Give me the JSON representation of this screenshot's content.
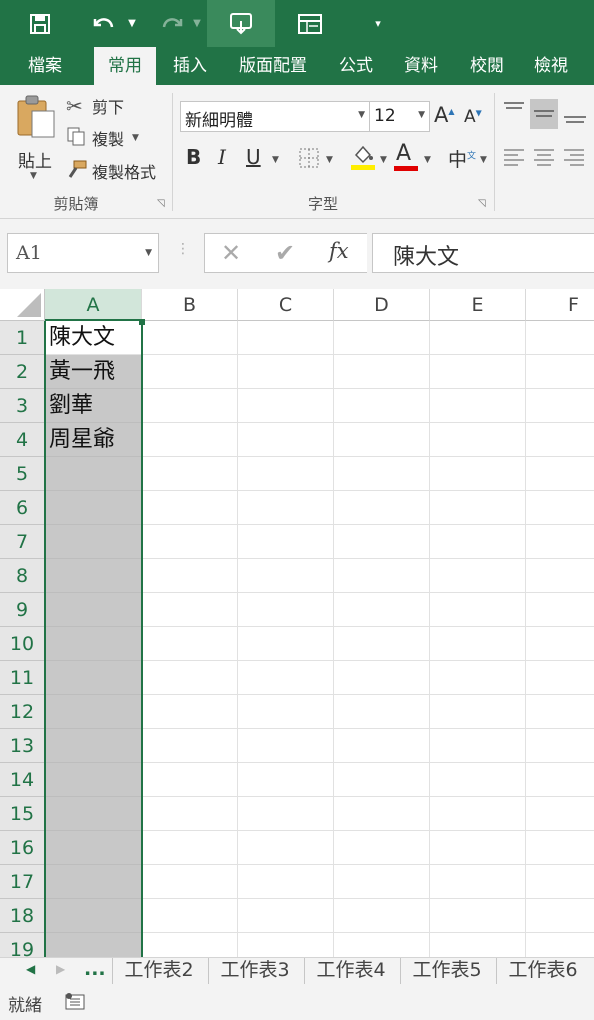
{
  "ribbon_tabs": [
    "檔案",
    "常用",
    "插入",
    "版面配置",
    "公式",
    "資料",
    "校閱",
    "檢視"
  ],
  "active_tab_index": 1,
  "clipboard": {
    "paste_label": "貼上",
    "cut_label": "剪下",
    "copy_label": "複製",
    "format_painter_label": "複製格式",
    "group_label": "剪貼簿"
  },
  "font": {
    "font_name": "新細明體",
    "font_size": "12",
    "bold": "B",
    "italic": "I",
    "underline": "U",
    "font_color_glyph": "A",
    "phonetic_glyph": "中",
    "grow_glyph": "A",
    "shrink_glyph": "A",
    "group_label": "字型"
  },
  "formula_bar": {
    "name_box": "A1",
    "fx": "fx",
    "content": "陳大文"
  },
  "columns": [
    "A",
    "B",
    "C",
    "D",
    "E",
    "F"
  ],
  "selected_column": "A",
  "rows": [
    "1",
    "2",
    "3",
    "4",
    "5",
    "6",
    "7",
    "8",
    "9",
    "10",
    "11",
    "12",
    "13",
    "14",
    "15",
    "16",
    "17",
    "18",
    "19"
  ],
  "cells_A": [
    "陳大文",
    "黃一飛",
    "劉華",
    "周星爺"
  ],
  "sheet_nav": {
    "more": "..."
  },
  "sheet_tabs": [
    "工作表2",
    "工作表3",
    "工作表4",
    "工作表5",
    "工作表6"
  ],
  "status": {
    "ready": "就緒"
  },
  "colors": {
    "accent": "#217346",
    "selection_gray": "#c8c8c8",
    "header_selected": "#d2e6da"
  }
}
